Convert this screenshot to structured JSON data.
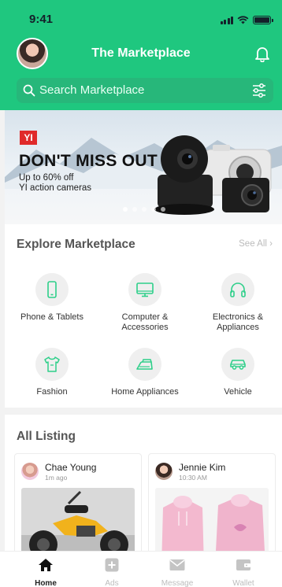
{
  "status_bar": {
    "time": "9:41"
  },
  "header": {
    "title": "The Marketplace"
  },
  "search": {
    "placeholder": "Search Marketplace"
  },
  "banner": {
    "logo": "YI",
    "headline": "DON'T MISS OUT",
    "subline1": "Up to 60% off",
    "subline2": "YI action cameras"
  },
  "explore": {
    "title": "Explore Marketplace",
    "see_all": "See All",
    "categories": [
      {
        "label": "Phone & Tablets",
        "icon": "phone-icon"
      },
      {
        "label": "Computer & Accessories",
        "icon": "monitor-icon"
      },
      {
        "label": "Electronics & Appliances",
        "icon": "headphones-icon"
      },
      {
        "label": "Fashion",
        "icon": "tshirt-icon"
      },
      {
        "label": "Home Appliances",
        "icon": "iron-icon"
      },
      {
        "label": "Vehicle",
        "icon": "car-icon"
      }
    ]
  },
  "listing": {
    "title": "All Listing",
    "items": [
      {
        "name": "Chae Young",
        "time": "1m ago"
      },
      {
        "name": "Jennie Kim",
        "time": "10:30 AM"
      }
    ]
  },
  "tabbar": {
    "tabs": [
      {
        "label": "Home",
        "icon": "home-icon",
        "active": true
      },
      {
        "label": "Ads",
        "icon": "plus-square-icon"
      },
      {
        "label": "Message",
        "icon": "mail-icon"
      },
      {
        "label": "Wallet",
        "icon": "wallet-icon"
      }
    ]
  },
  "colors": {
    "brand": "#1fc77f",
    "accent_icon": "#2ecf8a"
  }
}
